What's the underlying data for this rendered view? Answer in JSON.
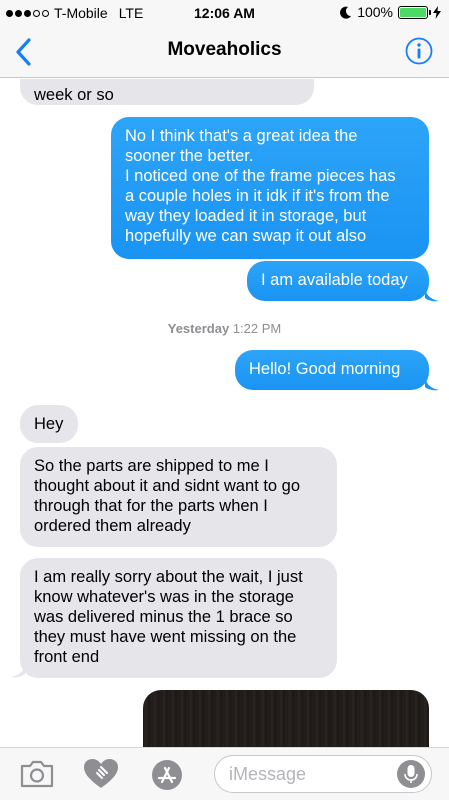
{
  "status_bar": {
    "carrier": "T-Mobile",
    "network": "LTE",
    "time": "12:06 AM",
    "battery_percent": "100%",
    "battery_level": 1.0
  },
  "nav": {
    "title": "Moveaholics"
  },
  "messages": [
    {
      "direction": "in",
      "lines": [
        "week or so"
      ]
    },
    {
      "direction": "out",
      "lines": [
        "No I think that's a great idea the",
        "sooner the better.",
        "I noticed one of the frame pieces has",
        "a couple holes in it idk if it's from the",
        "way they loaded it in storage, but",
        "hopefully we can swap it out also"
      ]
    },
    {
      "direction": "out",
      "lines": [
        "I am available today"
      ]
    },
    {
      "direction": "out",
      "lines": [
        "Hello! Good morning"
      ]
    },
    {
      "direction": "in",
      "lines": [
        "Hey"
      ]
    },
    {
      "direction": "in",
      "lines": [
        "So the parts are shipped to me I",
        "thought about it and sidnt want to go",
        "through that for the parts when I",
        "ordered them already"
      ]
    },
    {
      "direction": "in",
      "lines": [
        "I am really sorry about the wait, I just",
        "know whatever's was in the storage",
        "was delivered minus the 1 brace so",
        "they must have went missing on the",
        "front end"
      ]
    }
  ],
  "timestamp": {
    "day": "Yesterday",
    "time": "1:22 PM"
  },
  "input": {
    "placeholder": "iMessage"
  },
  "icons": {
    "back": "chevron-left-icon",
    "info": "info-icon",
    "camera": "camera-icon",
    "digital_touch": "heart-hand-icon",
    "apps": "app-store-icon",
    "mic": "microphone-icon"
  },
  "colors": {
    "accent": "#147efb",
    "outgoing_bubble": "#1d9bf6",
    "incoming_bubble": "#e5e5ea",
    "battery": "#4cd964"
  }
}
